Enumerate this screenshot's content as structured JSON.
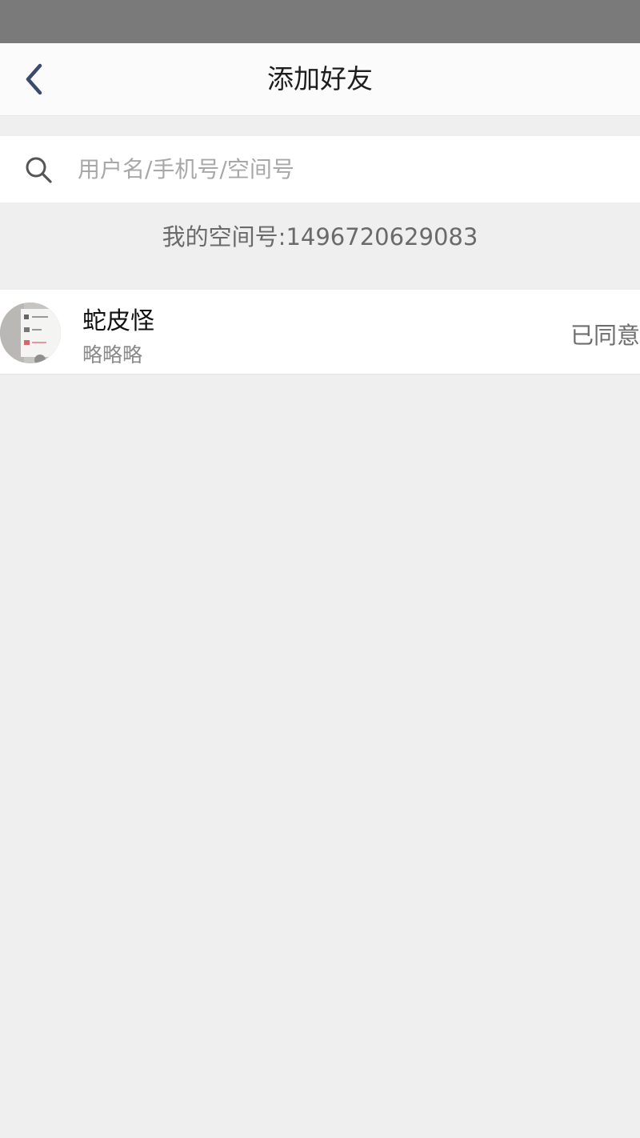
{
  "colors": {
    "status_bar": "#7a7a7a",
    "page_background": "#efefef",
    "back_icon": "#3c4a70"
  },
  "header": {
    "back_icon": "chevron-left-icon",
    "title": "添加好友"
  },
  "search": {
    "icon": "search-icon",
    "placeholder": "用户名/手机号/空间号",
    "value": ""
  },
  "my_space": {
    "text": "我的空间号:1496720629083"
  },
  "friend_requests": [
    {
      "avatar": "avatar",
      "name": "蛇皮怪",
      "message": "略略略",
      "status": "已同意"
    }
  ]
}
